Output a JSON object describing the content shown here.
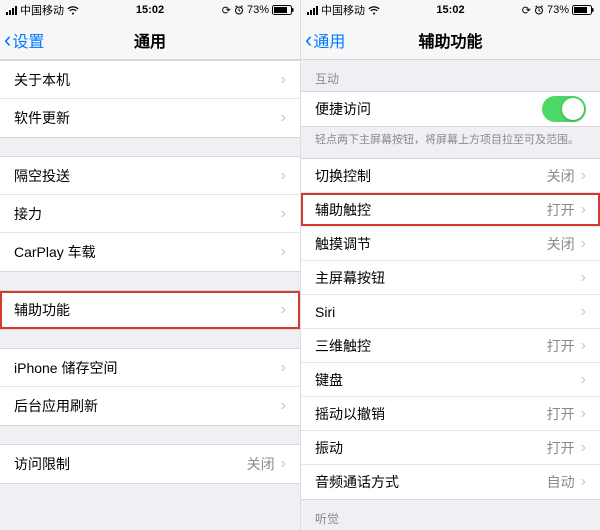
{
  "status": {
    "carrier": "中国移动",
    "time": "15:02",
    "battery_pct": "73%"
  },
  "left_phone": {
    "back_label": "设置",
    "title": "通用",
    "groups": [
      {
        "rows": [
          {
            "id": "about",
            "label": "关于本机"
          },
          {
            "id": "software-update",
            "label": "软件更新"
          }
        ]
      },
      {
        "rows": [
          {
            "id": "airdrop",
            "label": "隔空投送"
          },
          {
            "id": "handoff",
            "label": "接力"
          },
          {
            "id": "carplay",
            "label": "CarPlay 车载"
          }
        ]
      },
      {
        "rows": [
          {
            "id": "accessibility",
            "label": "辅助功能",
            "highlight": true
          }
        ]
      },
      {
        "rows": [
          {
            "id": "storage",
            "label": "iPhone 储存空间"
          },
          {
            "id": "background-refresh",
            "label": "后台应用刷新"
          }
        ]
      },
      {
        "rows": [
          {
            "id": "restrictions",
            "label": "访问限制",
            "value": "关闭"
          }
        ]
      }
    ]
  },
  "right_phone": {
    "back_label": "通用",
    "title": "辅助功能",
    "section_interact": "互动",
    "reachability": {
      "label": "便捷访问",
      "on": true
    },
    "reachability_footer": "轻点两下主屏幕按钮，将屏幕上方项目拉至可及范围。",
    "rows": [
      {
        "id": "switch-control",
        "label": "切换控制",
        "value": "关闭"
      },
      {
        "id": "assistive-touch",
        "label": "辅助触控",
        "value": "打开",
        "highlight": true
      },
      {
        "id": "touch-accommodations",
        "label": "触摸调节",
        "value": "关闭"
      },
      {
        "id": "home-button",
        "label": "主屏幕按钮"
      },
      {
        "id": "siri",
        "label": "Siri"
      },
      {
        "id": "three-d-touch",
        "label": "三维触控",
        "value": "打开"
      },
      {
        "id": "keyboard",
        "label": "键盘"
      },
      {
        "id": "shake-undo",
        "label": "摇动以撤销",
        "value": "打开"
      },
      {
        "id": "vibration",
        "label": "振动",
        "value": "打开"
      },
      {
        "id": "call-audio",
        "label": "音频通话方式",
        "value": "自动"
      }
    ],
    "section_hearing": "听觉"
  }
}
